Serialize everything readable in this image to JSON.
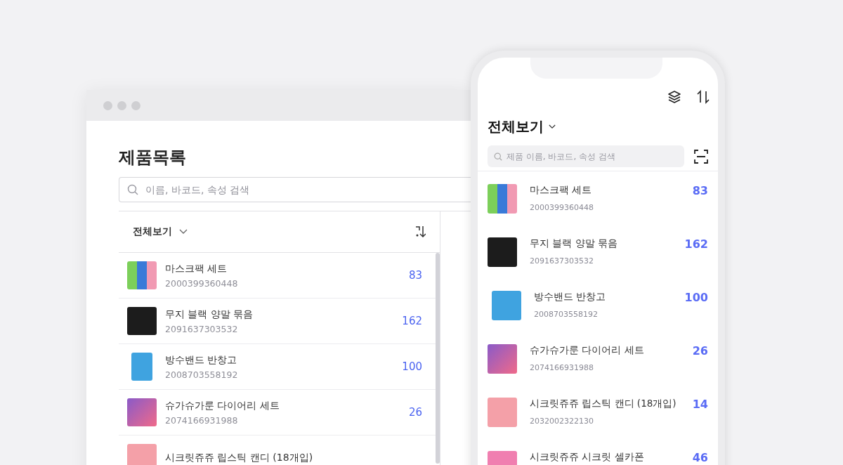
{
  "desktop": {
    "title": "제품목록",
    "search": {
      "placeholder": "이름, 바코드, 속성 검색"
    },
    "filter": "전체보기",
    "products": [
      {
        "name": "마스크팩 세트",
        "barcode": "2000399360448",
        "count": "83"
      },
      {
        "name": "무지 블랙 양말 묶음",
        "barcode": "2091637303532",
        "count": "162"
      },
      {
        "name": "방수밴드 반창고",
        "barcode": "2008703558192",
        "count": "100"
      },
      {
        "name": "슈가슈가룬 다이어리 세트",
        "barcode": "2074166931988",
        "count": "26"
      },
      {
        "name": "시크릿쥬쥬 립스틱 캔디 (18개입)"
      }
    ]
  },
  "phone": {
    "filter": "전체보기",
    "search": {
      "placeholder": "제품 이름, 바코드, 속성 검색"
    },
    "products": [
      {
        "name": "마스크팩 세트",
        "barcode": "2000399360448",
        "count": "83"
      },
      {
        "name": "무지 블랙 양말 묶음",
        "barcode": "2091637303532",
        "count": "162"
      },
      {
        "name": "방수밴드 반창고",
        "barcode": "2008703558192",
        "count": "100"
      },
      {
        "name": "슈가슈가룬 다이어리 세트",
        "barcode": "2074166931988",
        "count": "26"
      },
      {
        "name": "시크릿쥬쥬 립스틱 캔디 (18개입)",
        "barcode": "2032002322130",
        "count": "14"
      },
      {
        "name": "시크릿쥬쥬 시크릿 셀카폰",
        "count": "46"
      }
    ]
  }
}
